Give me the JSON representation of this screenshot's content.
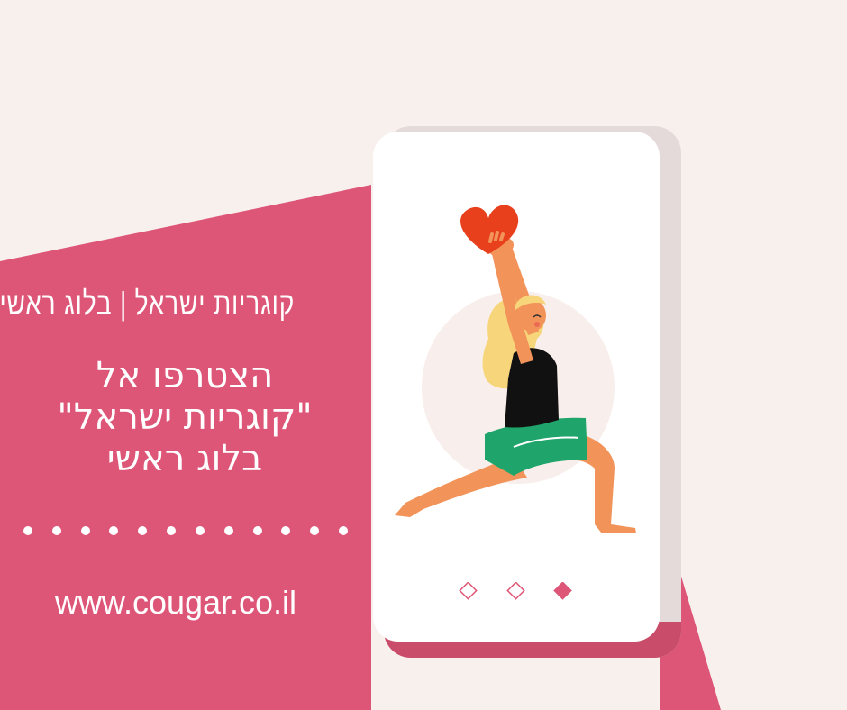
{
  "subtitle": "קוגריות ישראל | בלוג ראשי",
  "headline": {
    "line1": "הצטרפו אל",
    "line2": "\"קוגריות ישראל\"",
    "line3": "בלוג ראשי"
  },
  "url": "www.cougar.co.il",
  "pager": {
    "count": 3,
    "active_index": 2
  },
  "colors": {
    "background": "#f8f0ed",
    "accent": "#dd5677",
    "phone": "#ffffff",
    "heart": "#e8401c",
    "shorts": "#1fa56b"
  }
}
